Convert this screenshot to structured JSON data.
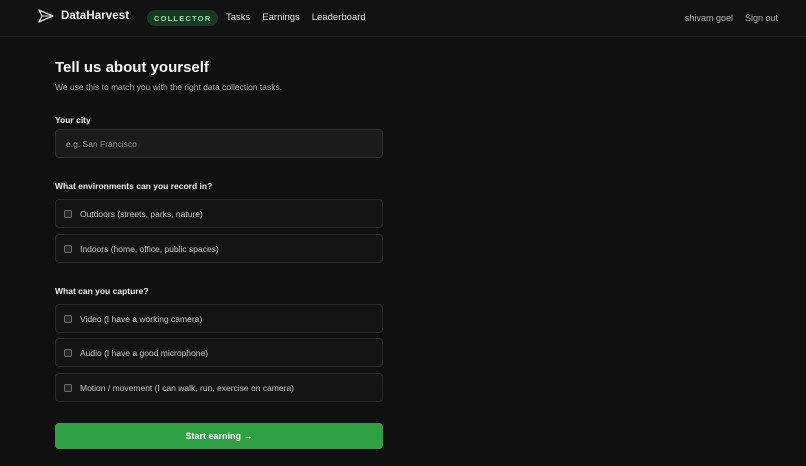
{
  "header": {
    "brand": "DataHarvest",
    "role_badge": "COLLECTOR",
    "nav": [
      "Tasks",
      "Earnings",
      "Leaderboard"
    ],
    "user": "shivam goel",
    "signout": "Sign out",
    "logo_icon": "paper-plane-icon"
  },
  "form": {
    "title": "Tell us about yourself",
    "subtitle": "We use this to match you with the right data collection tasks.",
    "city_label": "Your city",
    "city_placeholder": "e.g. San Francisco",
    "city_value": "",
    "env_label": "What environments can you record in?",
    "env_options": [
      {
        "label": "Outdoors (streets, parks, nature)",
        "checked": false
      },
      {
        "label": "Indoors (home, office, public spaces)",
        "checked": false
      }
    ],
    "capture_label": "What can you capture?",
    "capture_options": [
      {
        "label": "Video (I have a working camera)",
        "checked": false
      },
      {
        "label": "Audio (I have a good microphone)",
        "checked": false
      },
      {
        "label": "Motion / movement (I can walk, run, exercise on camera)",
        "checked": false
      }
    ],
    "submit": "Start earning →"
  },
  "colors": {
    "background": "#101010",
    "accent": "#2ea043",
    "badge_bg": "#183a22",
    "badge_text": "#8fdca3"
  }
}
